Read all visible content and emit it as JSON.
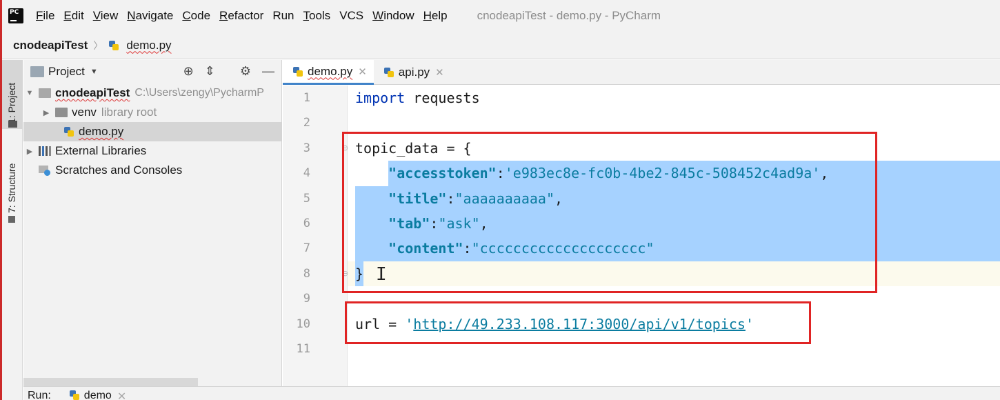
{
  "menu": {
    "items": [
      {
        "label": "File",
        "u": "F",
        "rest": "ile"
      },
      {
        "label": "Edit",
        "u": "E",
        "rest": "dit"
      },
      {
        "label": "View",
        "u": "V",
        "rest": "iew"
      },
      {
        "label": "Navigate",
        "u": "N",
        "rest": "avigate"
      },
      {
        "label": "Code",
        "u": "C",
        "rest": "ode"
      },
      {
        "label": "Refactor",
        "u": "R",
        "rest": "efactor"
      },
      {
        "label": "Run",
        "u": "",
        "rest": "Run"
      },
      {
        "label": "Tools",
        "u": "T",
        "rest": "ools"
      },
      {
        "label": "VCS",
        "u": "",
        "rest": "VCS"
      },
      {
        "label": "Window",
        "u": "W",
        "rest": "indow"
      },
      {
        "label": "Help",
        "u": "H",
        "rest": "elp"
      }
    ],
    "window_title": "cnodeapiTest - demo.py - PyCharm"
  },
  "breadcrumb": {
    "project": "cnodeapiTest",
    "file": "demo.py"
  },
  "toolstrip": {
    "project_label": "1: Project",
    "structure_label": "7: Structure"
  },
  "project_panel": {
    "title": "Project",
    "tree": {
      "root_name": "cnodeapiTest",
      "root_path": "C:\\Users\\zengy\\PycharmP",
      "venv_name": "venv",
      "venv_hint": "library root",
      "file": "demo.py",
      "external": "External Libraries",
      "scratches": "Scratches and Consoles"
    }
  },
  "tabs": [
    {
      "label": "demo.py",
      "active": true
    },
    {
      "label": "api.py",
      "active": false
    }
  ],
  "editor": {
    "line_numbers": [
      "1",
      "2",
      "3",
      "4",
      "5",
      "6",
      "7",
      "8",
      "9",
      "10",
      "11"
    ],
    "code": {
      "l1_kw": "import",
      "l1_rest": " requests",
      "l3": "topic_data = {",
      "l4_key": "\"accesstoken\"",
      "l4_colon": ":",
      "l4_val": "'e983ec8e-fc0b-4be2-845c-508452c4ad9a'",
      "l4_end": ",",
      "l5_key": "\"title\"",
      "l5_colon": ":",
      "l5_val": "\"aaaaaaaaaa\"",
      "l5_end": ",",
      "l6_key": "\"tab\"",
      "l6_colon": ":",
      "l6_val": "\"ask\"",
      "l6_end": ",",
      "l7_key": "\"content\"",
      "l7_colon": ":",
      "l7_val": "\"cccccccccccccccccccc\"",
      "l8": "}",
      "l10_pre": "url = ",
      "l10_q1": "'",
      "l10_url": "http://49.233.108.117:3000/api/v1/topics",
      "l10_q2": "'"
    }
  },
  "runbar": {
    "label": "Run:",
    "config": "demo"
  }
}
